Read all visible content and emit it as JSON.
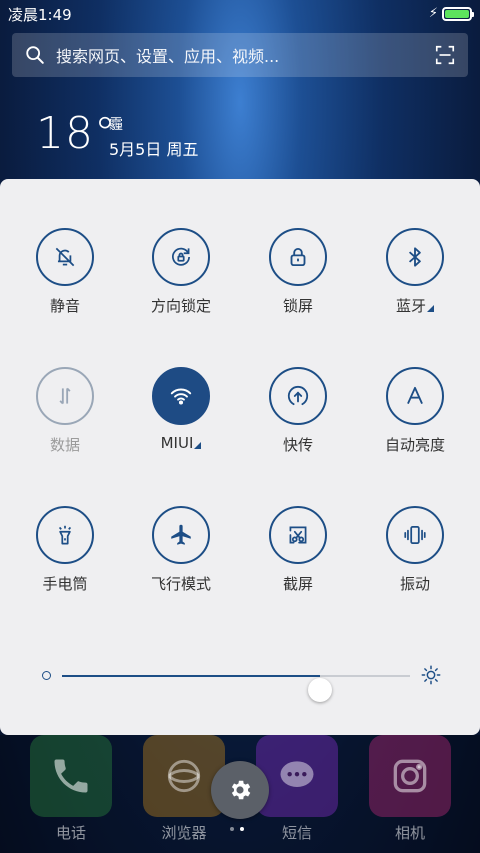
{
  "status_bar": {
    "time": "凌晨1:49",
    "battery_level": 1.0,
    "charging": true,
    "battery_color": "#5de35d"
  },
  "search": {
    "placeholder": "搜索网页、设置、应用、视频..."
  },
  "weather": {
    "temperature": "18°",
    "condition": "霾",
    "date": "5月5日 周五"
  },
  "quick_settings": {
    "accent_color": "#1e4b84",
    "toggles": [
      {
        "label": "静音",
        "icon": "silent-bell-icon",
        "state": "off"
      },
      {
        "label": "方向锁定",
        "icon": "rotation-lock-icon",
        "state": "off"
      },
      {
        "label": "锁屏",
        "icon": "lock-icon",
        "state": "off"
      },
      {
        "label": "蓝牙",
        "icon": "bluetooth-icon",
        "state": "off",
        "has_submenu": true
      },
      {
        "label": "数据",
        "icon": "mobile-data-icon",
        "state": "disabled"
      },
      {
        "label": "MIUI",
        "icon": "wifi-icon",
        "state": "on",
        "has_submenu": true
      },
      {
        "label": "快传",
        "icon": "quick-transfer-icon",
        "state": "off"
      },
      {
        "label": "自动亮度",
        "icon": "auto-brightness-icon",
        "state": "off"
      },
      {
        "label": "手电筒",
        "icon": "flashlight-icon",
        "state": "off"
      },
      {
        "label": "飞行模式",
        "icon": "airplane-icon",
        "state": "off"
      },
      {
        "label": "截屏",
        "icon": "screenshot-icon",
        "state": "off"
      },
      {
        "label": "振动",
        "icon": "vibrate-icon",
        "state": "off"
      }
    ],
    "brightness": {
      "level": 0.74
    }
  },
  "dock": {
    "apps": [
      {
        "label": "电话",
        "icon": "phone-icon",
        "color": "#2e8b3e"
      },
      {
        "label": "浏览器",
        "icon": "browser-icon",
        "color": "#c98a1c"
      },
      {
        "label": "短信",
        "icon": "message-icon",
        "color": "#8a2fd0"
      },
      {
        "label": "相机",
        "icon": "camera-icon",
        "color": "#c42a7d"
      }
    ],
    "page_count": 2,
    "current_page": 2
  }
}
